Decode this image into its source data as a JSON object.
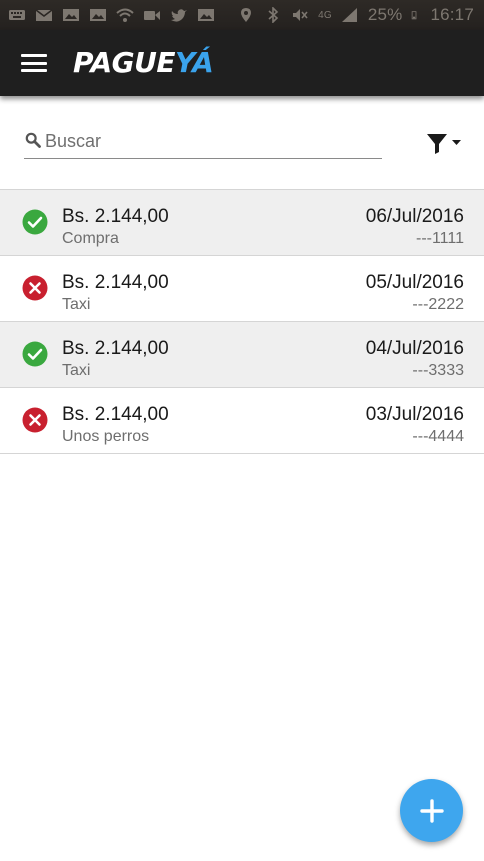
{
  "status_bar": {
    "battery_percent": "25%",
    "time": "16:17",
    "network_label": "4G",
    "icons_left": [
      "keyboard-icon",
      "mail-icon",
      "image-icon",
      "image-icon",
      "wifi-icon",
      "video-icon",
      "twitter-icon",
      "image-icon"
    ],
    "icons_right": [
      "location-icon",
      "bluetooth-icon",
      "mute-icon",
      "signal-icon",
      "battery-icon"
    ]
  },
  "app_bar": {
    "logo_text_main": "PAGUE",
    "logo_text_accent": "YÁ",
    "accent_color": "#3aa3ec",
    "background_color": "#1f1f1f",
    "icons": [
      "menu-icon",
      "lock-icon"
    ]
  },
  "search": {
    "placeholder": "Buscar",
    "value": "",
    "filter_icon": "filter-icon"
  },
  "transactions": [
    {
      "amount": "Bs. 2.144,00",
      "description": "Compra",
      "date": "06/Jul/2016",
      "card": "---1111",
      "status": "approved"
    },
    {
      "amount": "Bs. 2.144,00",
      "description": "Taxi",
      "date": "05/Jul/2016",
      "card": "---2222",
      "status": "rejected"
    },
    {
      "amount": "Bs. 2.144,00",
      "description": "Taxi",
      "date": "04/Jul/2016",
      "card": "---3333",
      "status": "approved"
    },
    {
      "amount": "Bs. 2.144,00",
      "description": "Unos perros",
      "date": "03/Jul/2016",
      "card": "---4444",
      "status": "rejected"
    }
  ],
  "status_colors": {
    "approved": "#3aa83f",
    "rejected": "#c8202f"
  },
  "fab": {
    "icon": "plus-icon",
    "color": "#3ea6ee"
  }
}
